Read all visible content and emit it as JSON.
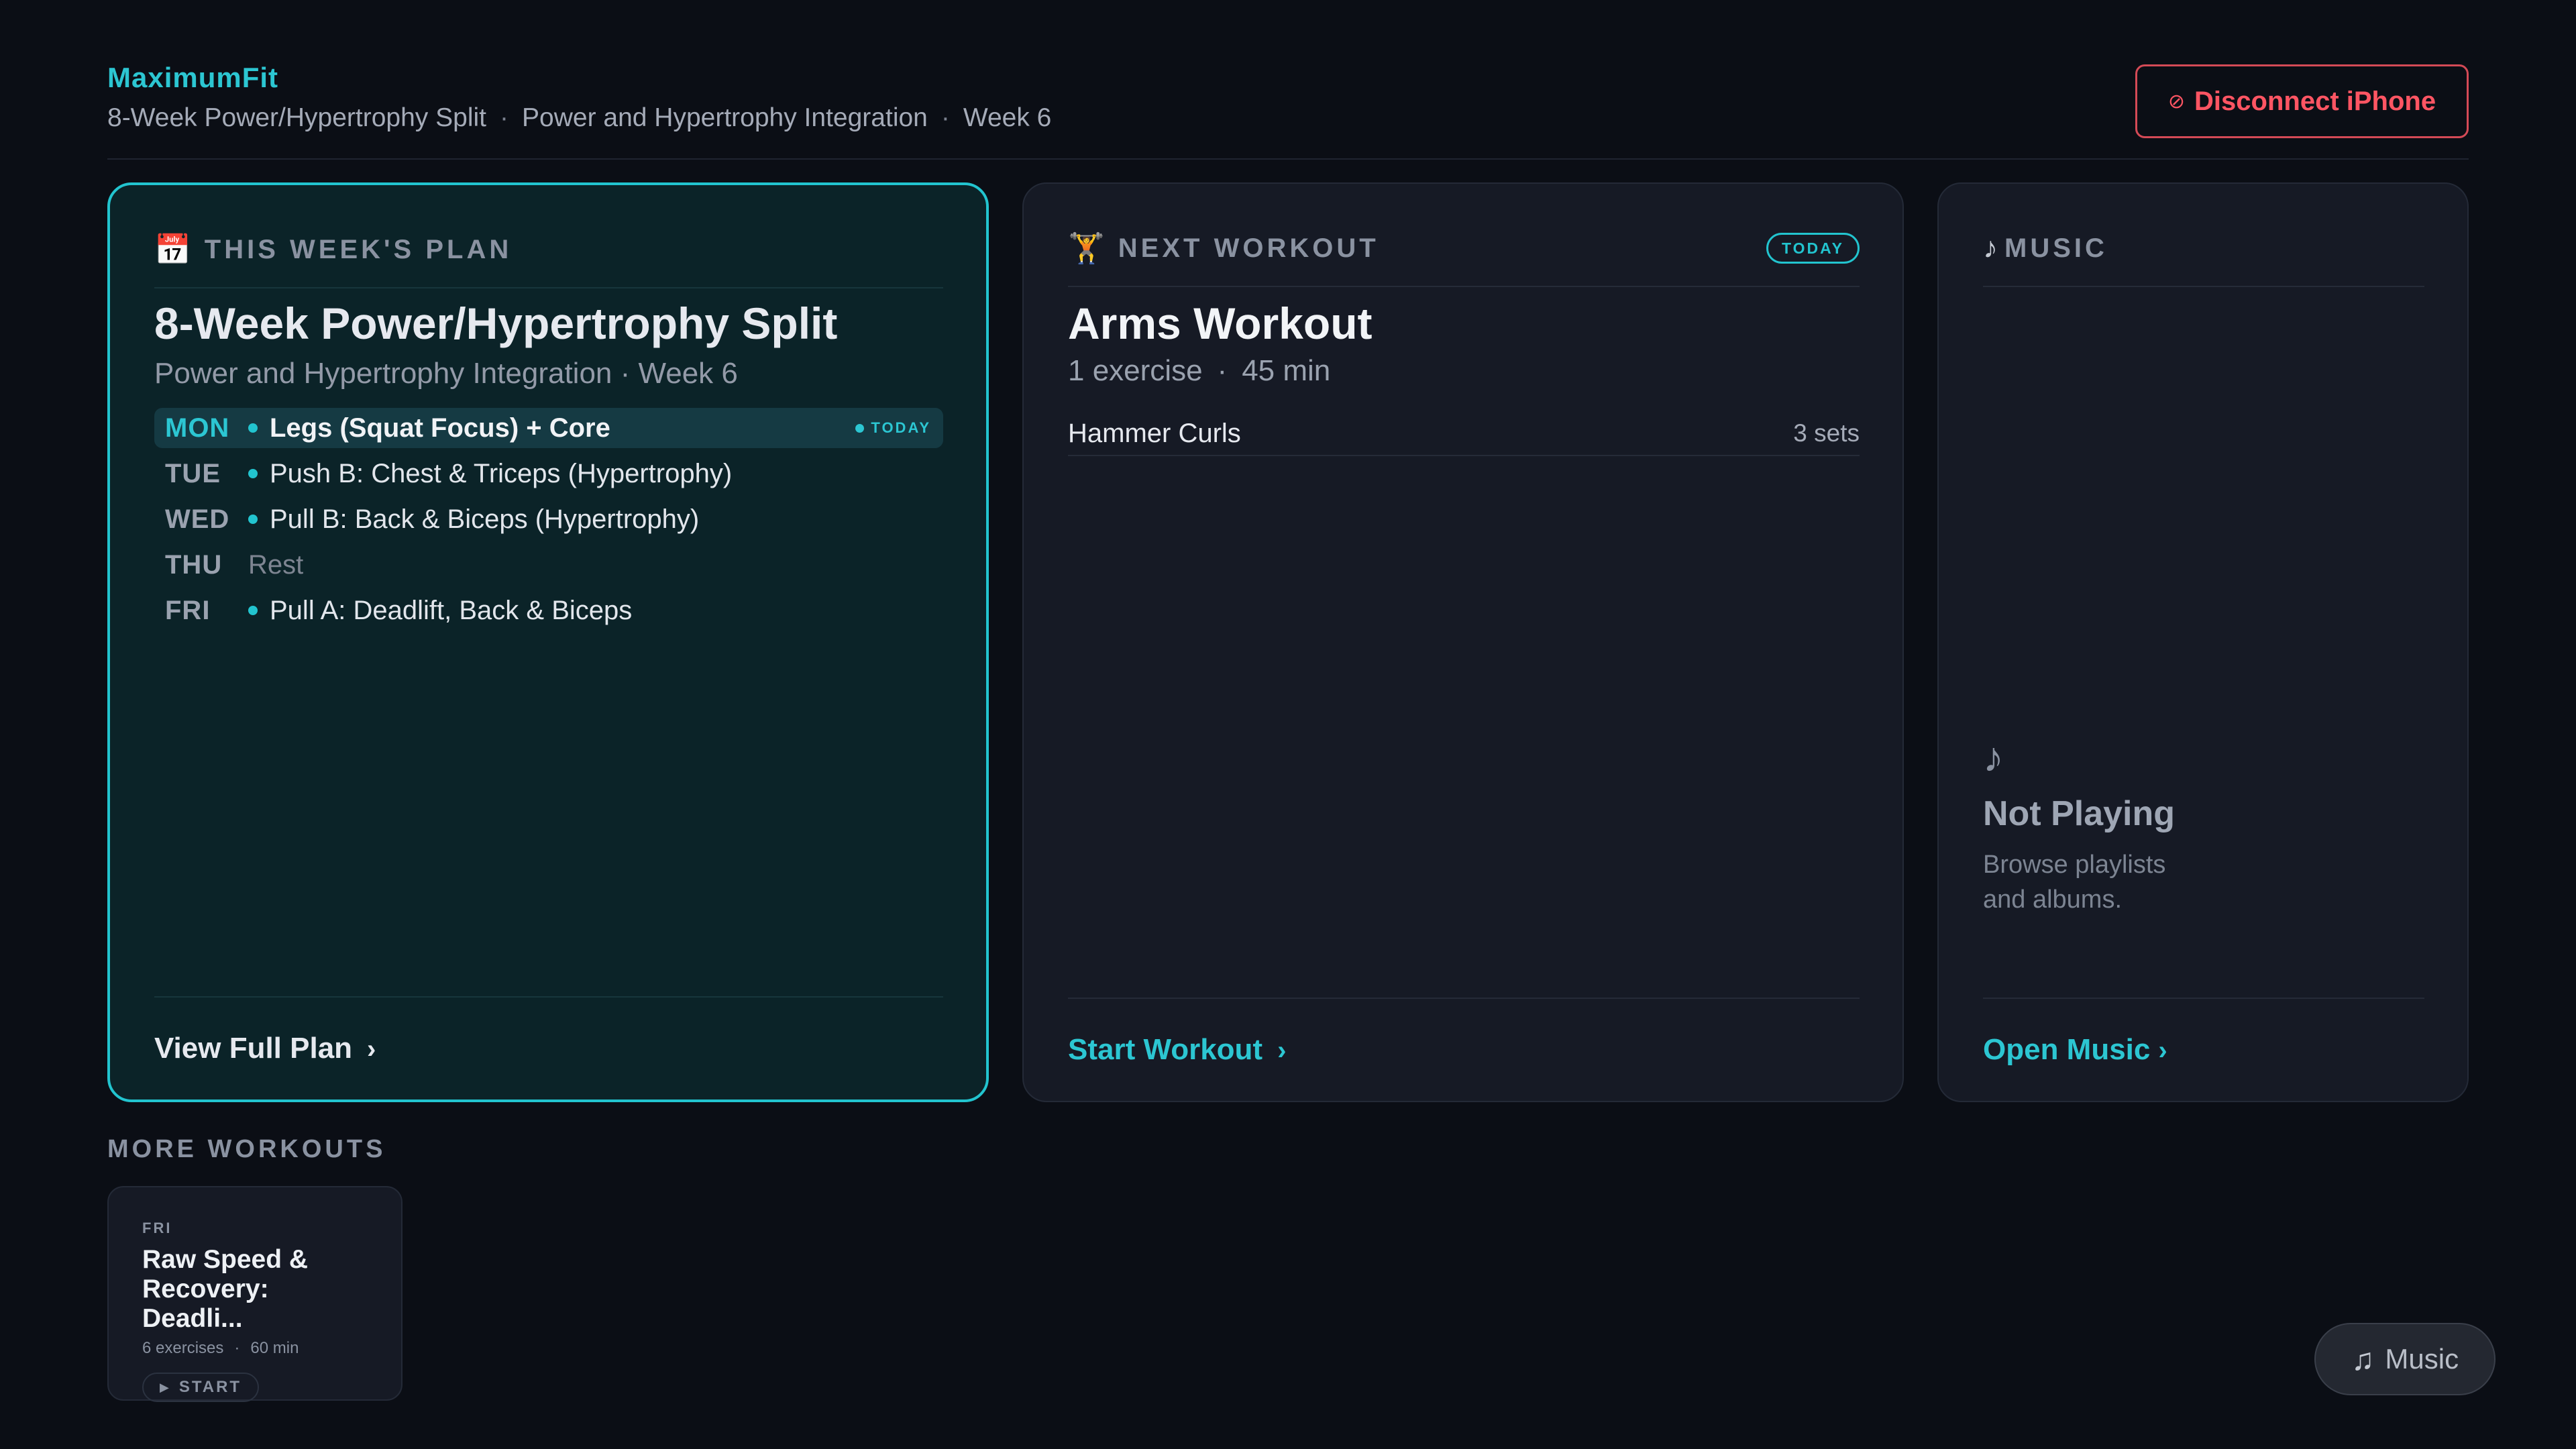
{
  "header": {
    "brand": "MaximumFit",
    "crumbs": [
      "8-Week Power/Hypertrophy Split",
      "Power and Hypertrophy Integration",
      "Week 6"
    ],
    "crumb_separator": "·",
    "disconnect_icon": "⊘",
    "disconnect_label": "Disconnect iPhone"
  },
  "plan_card": {
    "icon": "📅",
    "heading": "THIS WEEK'S PLAN",
    "title": "8-Week Power/Hypertrophy Split",
    "subtitle": "Power and Hypertrophy Integration · Week 6",
    "days": [
      {
        "day": "MON",
        "title": "Legs (Squat Focus) + Core",
        "today_label": "TODAY"
      },
      {
        "day": "TUE",
        "title": "Push B: Chest & Triceps (Hypertrophy)"
      },
      {
        "day": "WED",
        "title": "Pull B: Back & Biceps (Hypertrophy)"
      },
      {
        "day": "THU",
        "title": "Rest"
      },
      {
        "day": "FRI",
        "title": "Pull A: Deadlift, Back & Biceps"
      }
    ],
    "footer_link": "View Full Plan",
    "chevron": "›"
  },
  "next_card": {
    "icon": "🏋",
    "heading": "NEXT WORKOUT",
    "badge": "TODAY",
    "title": "Arms Workout",
    "meta": [
      "1 exercise",
      "·",
      "45 min"
    ],
    "exercises": [
      {
        "name": "Hammer Curls",
        "sets": "3 sets"
      }
    ],
    "footer_link": "Start Workout",
    "chevron": "›"
  },
  "music_card": {
    "icon": "♪",
    "heading": "MUSIC",
    "note": "♪",
    "status": "Not Playing",
    "hint": "Browse playlists and albums.",
    "footer_link": "Open Music",
    "chevron": "›"
  },
  "more": {
    "label": "MORE WORKOUTS",
    "items": [
      {
        "day": "FRI",
        "title": "Raw Speed & Recovery: Deadli...",
        "meta": [
          "6 exercises",
          "·",
          "60 min"
        ],
        "start": "START",
        "start_icon": "▶"
      }
    ]
  },
  "music_fab": {
    "icon": "♫",
    "label": "Music"
  },
  "colors": {
    "accent": "#22c4cf",
    "danger": "#ff5563",
    "background": "#0b0e15",
    "card": "#161a25"
  }
}
